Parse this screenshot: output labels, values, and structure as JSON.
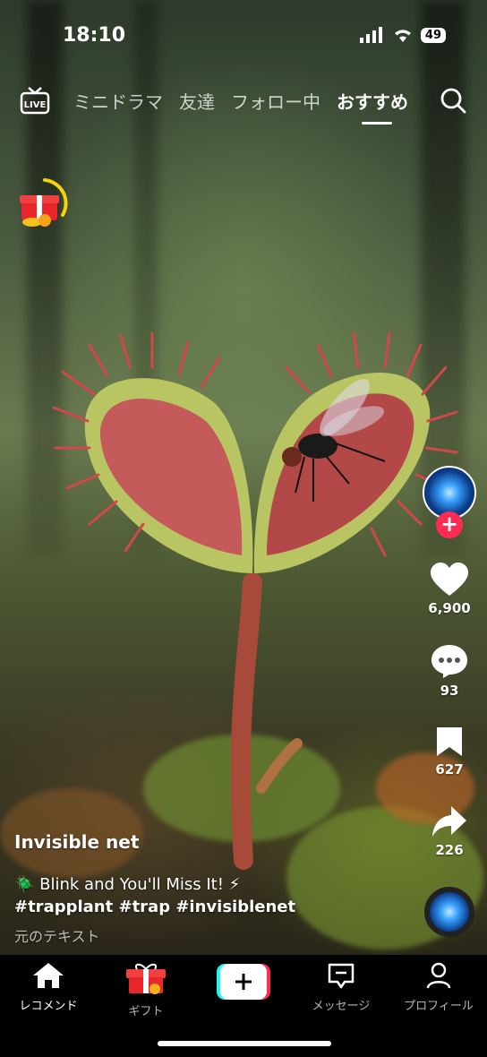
{
  "status": {
    "time": "18:10",
    "battery": "49"
  },
  "top_nav": {
    "tabs": [
      {
        "label": "ミニドラマ"
      },
      {
        "label": "友達"
      },
      {
        "label": "フォロー中"
      },
      {
        "label": "おすすめ"
      }
    ],
    "active_tab": "おすすめ"
  },
  "actions": {
    "likes": "6,900",
    "comments": "93",
    "saves": "627",
    "shares": "226"
  },
  "caption": {
    "username": "Invisible net",
    "description": "🪲 Blink and You'll Miss It! ⚡",
    "hashtags": "#trapplant #trap  #invisiblenet",
    "original_text": "元のテキスト"
  },
  "bottom_nav": {
    "home": "レコメンド",
    "gift": "ギフト",
    "messages": "メッセージ",
    "profile": "プロフィール"
  },
  "colors": {
    "accent": "#fe2c55",
    "cyan": "#25f4ee"
  }
}
